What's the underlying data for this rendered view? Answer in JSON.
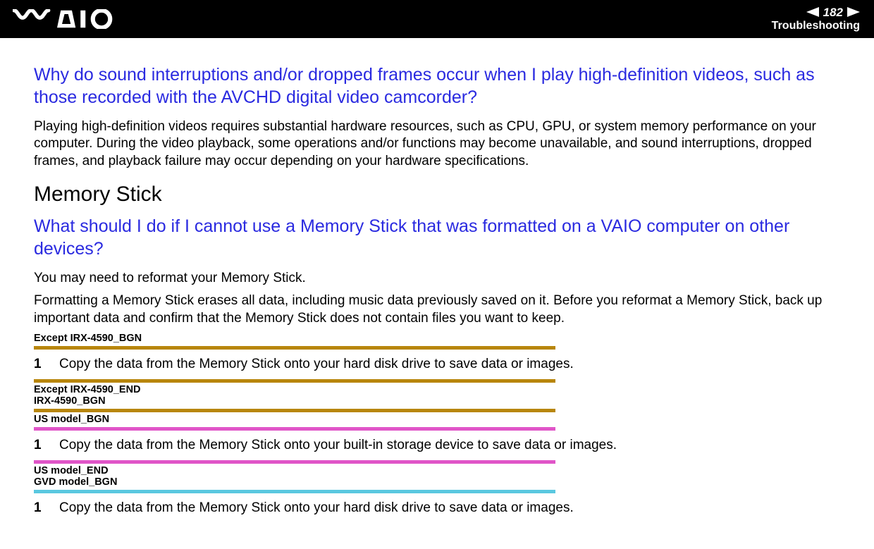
{
  "header": {
    "page_number": "182",
    "section": "Troubleshooting"
  },
  "q1": {
    "title": "Why do sound interruptions and/or dropped frames occur when I play high-definition videos, such as those recorded with the AVCHD digital video camcorder?",
    "body": "Playing high-definition videos requires substantial hardware resources, such as CPU, GPU, or system memory performance on your computer. During the video playback, some operations and/or functions may become unavailable, and sound interruptions, dropped frames, and playback failure may occur depending on your hardware specifications."
  },
  "section2": {
    "title": "Memory Stick"
  },
  "q2": {
    "title": "What should I do if I cannot use a Memory Stick that was formatted on a VAIO computer on other devices?",
    "p1": "You may need to reformat your Memory Stick.",
    "p2": "Formatting a Memory Stick erases all data, including music data previously saved on it. Before you reformat a Memory Stick, back up important data and confirm that the Memory Stick does not contain files you want to keep."
  },
  "markers": {
    "m1": "Except IRX-4590_BGN",
    "m2a": "Except IRX-4590_END",
    "m2b": "IRX-4590_BGN",
    "m3": "US model_BGN",
    "m4a": "US model_END",
    "m4b": "GVD model_BGN"
  },
  "steps": {
    "num": "1",
    "s1": "Copy the data from the Memory Stick onto your hard disk drive to save data or images.",
    "s2": "Copy the data from the Memory Stick onto your built-in storage device to save data or images.",
    "s3": "Copy the data from the Memory Stick onto your hard disk drive to save data or images."
  }
}
